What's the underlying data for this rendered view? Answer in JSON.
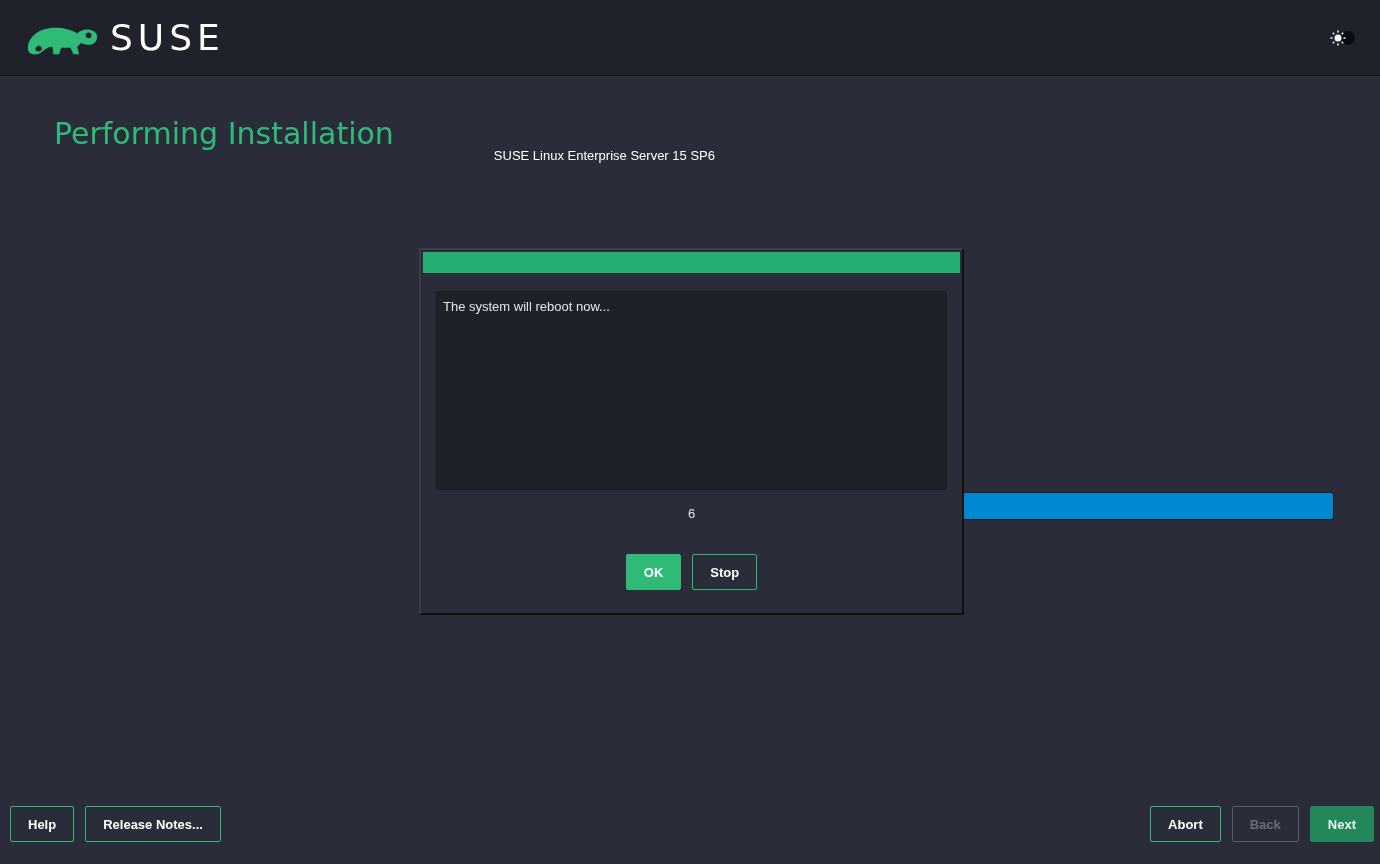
{
  "header": {
    "brand": "SUSE"
  },
  "page": {
    "title": "Performing Installation",
    "product": "SUSE Linux Enterprise Server 15 SP6",
    "progress": {
      "level": 1
    }
  },
  "dialog": {
    "message": "The system will reboot now...",
    "countdown": "6",
    "buttons": [
      {
        "label": "OK",
        "kind": "primary"
      },
      {
        "label": "Stop",
        "kind": "secondary"
      }
    ]
  },
  "footer": {
    "left": [
      {
        "label": "Help",
        "disabled": false,
        "kind": "secondary"
      },
      {
        "label": "Release Notes...",
        "disabled": false,
        "kind": "secondary"
      }
    ],
    "right": [
      {
        "label": "Abort",
        "disabled": false,
        "kind": "secondary"
      },
      {
        "label": "Back",
        "disabled": true,
        "kind": "secondary"
      },
      {
        "label": "Next",
        "disabled": true,
        "kind": "primary"
      }
    ]
  }
}
